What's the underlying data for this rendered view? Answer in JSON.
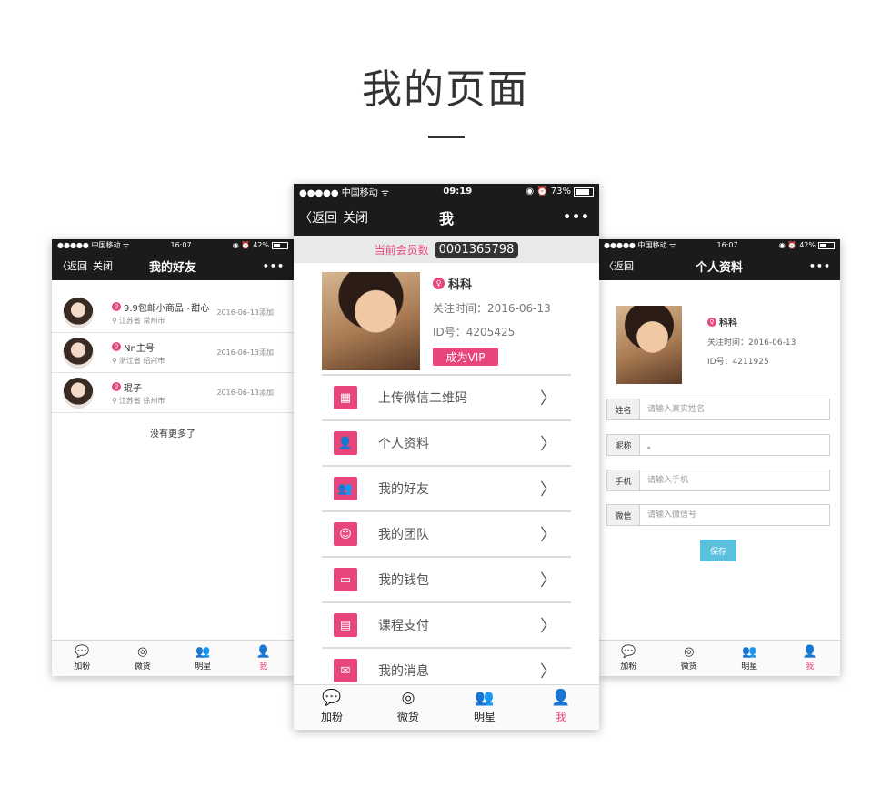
{
  "page_title": "我的页面",
  "left_screen": {
    "status": {
      "carrier": "●●●●● 中国移动 ᯤ",
      "time": "16:07",
      "icons": "◉ ⏰",
      "battery": "42%",
      "battery_level": 0.42
    },
    "nav": {
      "back": "〈返回",
      "close": "关闭",
      "title": "我的好友",
      "more": "•••"
    },
    "friends": [
      {
        "name": "9.9包邮小商品~甜心",
        "location": "江苏省 常州市",
        "date": "2016-06-13添加"
      },
      {
        "name": "Nn主号",
        "location": "浙江省 绍兴市",
        "date": "2016-06-13添加"
      },
      {
        "name": "琨子",
        "location": "江苏省 徐州市",
        "date": "2016-06-13添加"
      }
    ],
    "no_more": "没有更多了",
    "tabs": [
      {
        "label": "加粉",
        "icon": "speech-bubble"
      },
      {
        "label": "微货",
        "icon": "compass"
      },
      {
        "label": "明星",
        "icon": "people"
      },
      {
        "label": "我",
        "icon": "person",
        "active": true
      }
    ]
  },
  "center_screen": {
    "status": {
      "carrier": "●●●●● 中国移动 ᯤ",
      "time": "09:19",
      "icons": "◉ ⏰",
      "battery": "73%",
      "battery_level": 0.73
    },
    "nav": {
      "back": "〈返回",
      "close": "关闭",
      "title": "我",
      "more": "•••"
    },
    "member_label": "当前会员数",
    "member_count": "0001365798",
    "profile": {
      "name": "科科",
      "follow_time": "关注时间：2016-06-13",
      "id": "ID号：4205425",
      "vip_button": "成为VIP"
    },
    "menu": [
      {
        "label": "上传微信二维码",
        "icon": "qr-code"
      },
      {
        "label": "个人资料",
        "icon": "person"
      },
      {
        "label": "我的好友",
        "icon": "friends"
      },
      {
        "label": "我的团队",
        "icon": "team"
      },
      {
        "label": "我的钱包",
        "icon": "wallet"
      },
      {
        "label": "课程支付",
        "icon": "card"
      },
      {
        "label": "我的消息",
        "icon": "message"
      }
    ],
    "tabs": [
      {
        "label": "加粉",
        "icon": "speech-bubble"
      },
      {
        "label": "微货",
        "icon": "compass"
      },
      {
        "label": "明星",
        "icon": "people"
      },
      {
        "label": "我",
        "icon": "person",
        "active": true
      }
    ]
  },
  "right_screen": {
    "status": {
      "carrier": "●●●●● 中国移动 ᯤ",
      "time": "16:07",
      "icons": "◉ ⏰",
      "battery": "42%",
      "battery_level": 0.42
    },
    "nav": {
      "back": "〈返回",
      "title": "个人资料",
      "more": "•••"
    },
    "profile": {
      "name": "科科",
      "follow_time": "关注时间：2016-06-13",
      "id": "ID号：4211925"
    },
    "form": [
      {
        "label": "姓名",
        "placeholder": "请输入真实姓名",
        "value": ""
      },
      {
        "label": "昵称",
        "placeholder": "",
        "value": "。"
      },
      {
        "label": "手机",
        "placeholder": "请输入手机",
        "value": ""
      },
      {
        "label": "微信",
        "placeholder": "请输入微信号",
        "value": ""
      }
    ],
    "save_button": "保存",
    "tabs": [
      {
        "label": "加粉",
        "icon": "speech-bubble"
      },
      {
        "label": "微货",
        "icon": "compass"
      },
      {
        "label": "明星",
        "icon": "people"
      },
      {
        "label": "我",
        "icon": "person",
        "active": true
      }
    ]
  },
  "colors": {
    "accent": "#e8457a",
    "navbar": "#1b1b1b",
    "save": "#5bc0de"
  }
}
